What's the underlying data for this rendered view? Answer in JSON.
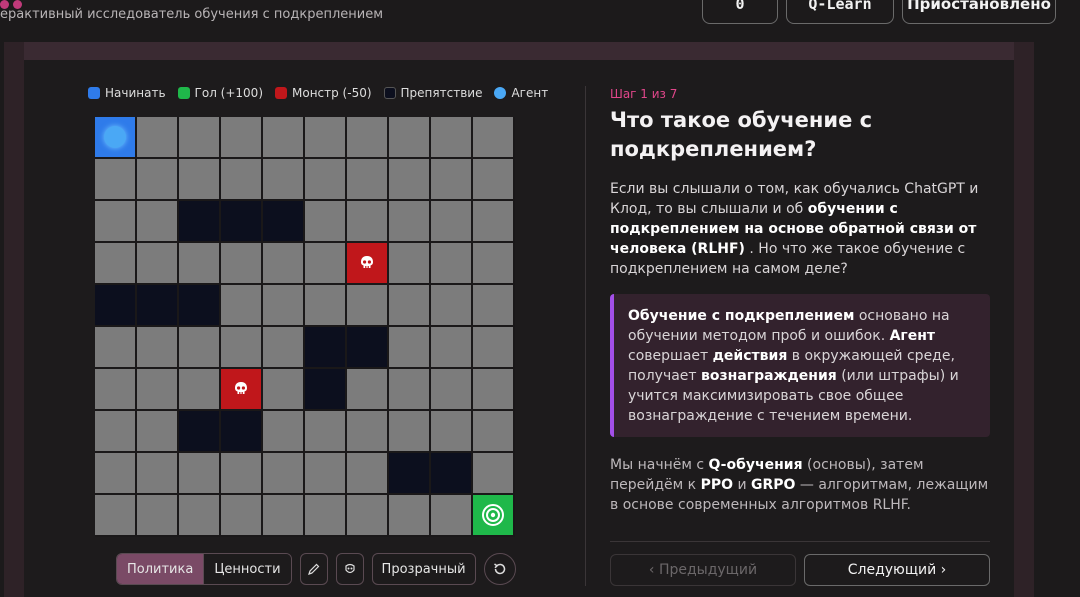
{
  "header": {
    "subtitle": "ерактивный исследователь обучения с подкреплением",
    "counter": "0",
    "algorithm": "Q-Learn",
    "status": "Приостановлено"
  },
  "legend": [
    {
      "label": "Начинать",
      "color": "#2f7bea"
    },
    {
      "label": "Гол (+100)",
      "color": "#1fb84a"
    },
    {
      "label": "Монстр (-50)",
      "color": "#c0171b"
    },
    {
      "label": "Препятствие",
      "color": "#0c0f1e"
    },
    {
      "label": "Агент",
      "color": "#4aa8f5"
    }
  ],
  "grid": {
    "rows": 10,
    "cols": 10,
    "start": [
      0,
      0
    ],
    "agent": [
      0,
      0
    ],
    "goal": [
      9,
      9
    ],
    "monsters": [
      [
        3,
        6
      ],
      [
        6,
        3
      ]
    ],
    "walls": [
      [
        2,
        2
      ],
      [
        2,
        3
      ],
      [
        2,
        4
      ],
      [
        4,
        0
      ],
      [
        4,
        1
      ],
      [
        4,
        2
      ],
      [
        5,
        5
      ],
      [
        5,
        6
      ],
      [
        6,
        5
      ],
      [
        7,
        2
      ],
      [
        7,
        3
      ],
      [
        8,
        7
      ],
      [
        8,
        8
      ]
    ]
  },
  "icons": {
    "monster": "skull-icon",
    "goal": "target-icon",
    "pencil": "pencil-icon",
    "mask": "mask-icon",
    "reset": "reset-icon"
  },
  "controls": {
    "policy": "Политика",
    "values": "Ценности",
    "transparent": "Прозрачный"
  },
  "lesson": {
    "step": "Шаг 1 из 7",
    "title": "Что такое обучение с подкреплением?",
    "p1": {
      "a": "Если вы слышали о том, как обучались ChatGPT и Клод, то вы слышали и об ",
      "b": "обучении с подкреплением на основе обратной связи от человека (RLHF)",
      "c": " . Но что же такое обучение с подкреплением на самом деле?"
    },
    "callout": {
      "b1": "Обучение с подкреплением",
      "t1": " основано на обучении методом проб и ошибок. ",
      "b2": "Агент",
      "t2": " совершает ",
      "b3": "действия",
      "t3": " в окружающей среде, получает ",
      "b4": "вознаграждения",
      "t4": " (или штрафы) и учится максимизировать свое общее вознаграждение с течением времени."
    },
    "p2": {
      "t1": "Мы начнём с ",
      "b1": "Q-обучения",
      "t2": " (основы), затем перейдём к ",
      "b2": "PPO",
      "t3": " и ",
      "b3": "GRPO",
      "t4": " — алгоритмам, лежащим в основе современных алгоритмов RLHF."
    }
  },
  "nav": {
    "prev": "‹  Предыдущий",
    "next": "Следующий  ›"
  }
}
